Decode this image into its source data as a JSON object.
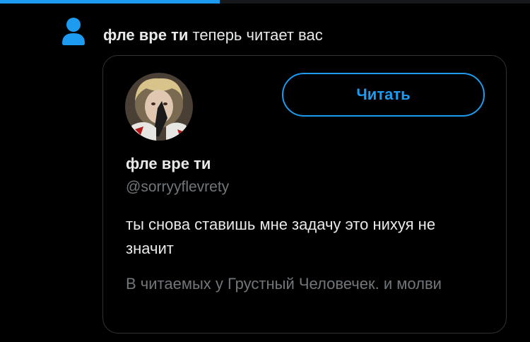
{
  "progress": {
    "fraction": 0.415,
    "color": "#1d9bf0"
  },
  "notification": {
    "icon": "person-icon",
    "actor_name": "фле вре ти",
    "action_text": "теперь читает вас"
  },
  "user_card": {
    "avatar": "user-avatar",
    "follow_button_label": "Читать",
    "display_name": "фле вре ти",
    "handle": "@sorryyflevrety",
    "bio": "ты снова ставишь мне задачу это нихуя не значит",
    "followed_by": "В читаемых у Грустный Человечек. и молви"
  },
  "colors": {
    "accent": "#1d9bf0",
    "background": "#000000",
    "primary_text": "#e7e9ea",
    "secondary_text": "#71767b",
    "border": "#2f3336"
  }
}
